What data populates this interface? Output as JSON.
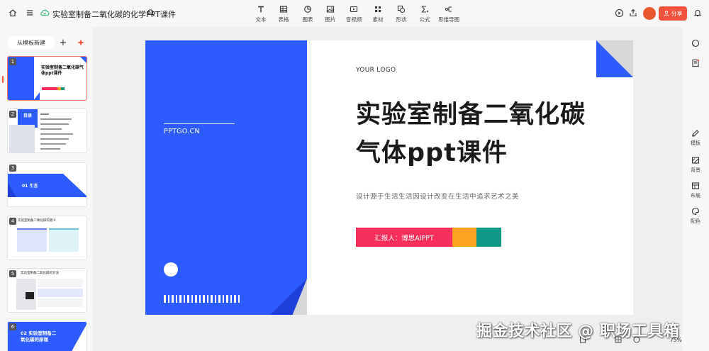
{
  "colors": {
    "accent": "#f0523d",
    "slide_blue": "#2d5bff",
    "reporter_pink": "#f72f5c",
    "orange": "#fda31f",
    "teal": "#0e9886"
  },
  "header": {
    "doc_title": "实验室制备二氧化碳的化学PPT课件",
    "share_label": "分享",
    "avatar_text": "avatar",
    "tools": [
      {
        "label": "文本",
        "icon": "text-icon"
      },
      {
        "label": "表格",
        "icon": "table-icon"
      },
      {
        "label": "图表",
        "icon": "chart-icon"
      },
      {
        "label": "图片",
        "icon": "image-icon"
      },
      {
        "label": "音视频",
        "icon": "media-icon"
      },
      {
        "label": "素材",
        "icon": "assets-icon"
      },
      {
        "label": "形状",
        "icon": "shape-icon"
      },
      {
        "label": "公式",
        "icon": "formula-icon"
      },
      {
        "label": "思维导图",
        "icon": "mindmap-icon"
      }
    ]
  },
  "sidebar": {
    "template_button": "从模板新建",
    "thumbnails": [
      {
        "num": "1",
        "title": "实验室制备二氧化碳气体ppt课件"
      },
      {
        "num": "2",
        "title": "目录"
      },
      {
        "num": "3",
        "title": "01 引言"
      },
      {
        "num": "4",
        "title": "实验室制备二氧化碳的意义"
      },
      {
        "num": "5",
        "title": "实验室制备二氧化碳的方法"
      },
      {
        "num": "6",
        "title": "02 实验室制备二氧化碳的原理"
      }
    ]
  },
  "slide": {
    "logo": "YOUR LOGO",
    "title_line1": "实验室制备二氧化碳",
    "title_line2": "气体ppt课件",
    "subtitle": "设计源于生活生活因设计改变在生活中追求艺术之美",
    "reporter": "汇报人：博思AIPPT",
    "url": "PPTGO.CN"
  },
  "right_panel": [
    {
      "label": "模板",
      "icon": "template-icon"
    },
    {
      "label": "背景",
      "icon": "background-icon"
    },
    {
      "label": "布局",
      "icon": "layout-icon"
    },
    {
      "label": "配色",
      "icon": "palette-icon"
    }
  ],
  "footer": {
    "zoom": "75%",
    "watermark": "掘金技术社区 @ 职场工具箱"
  }
}
